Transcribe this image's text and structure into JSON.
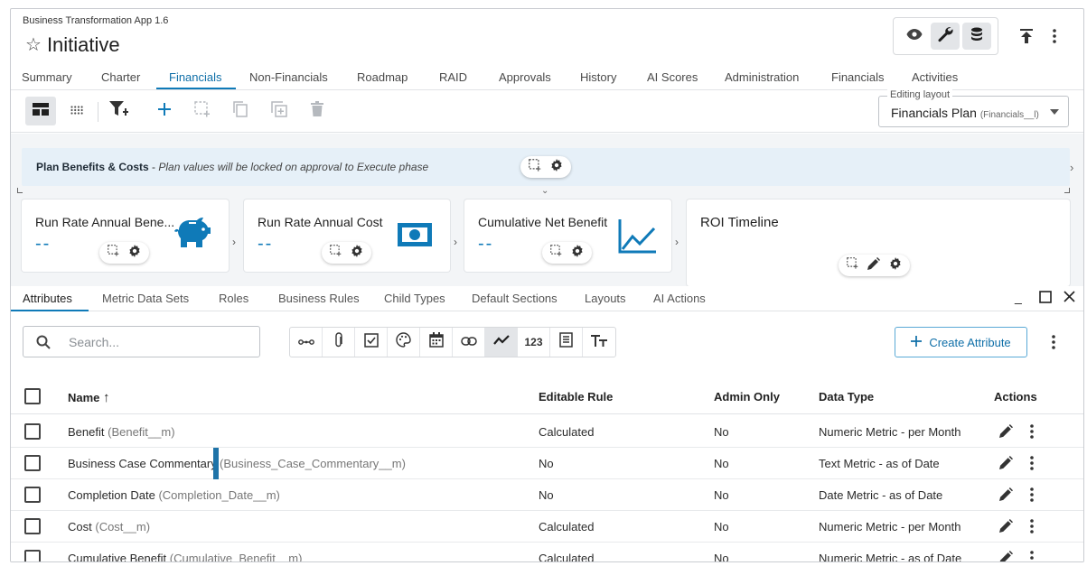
{
  "header": {
    "app_name": "Business Transformation App 1.6",
    "title": "Initiative",
    "star_icon": "☆"
  },
  "tabs": [
    {
      "label": "Summary"
    },
    {
      "label": "Charter"
    },
    {
      "label": "Financials",
      "active": true
    },
    {
      "label": "Non-Financials"
    },
    {
      "label": "Roadmap"
    },
    {
      "label": "RAID"
    },
    {
      "label": "Approvals"
    },
    {
      "label": "History"
    },
    {
      "label": "AI Scores"
    },
    {
      "label": "Administration"
    },
    {
      "label": "Financials"
    },
    {
      "label": "Activities"
    }
  ],
  "layout_select": {
    "label": "Editing layout",
    "value": "Financials Plan",
    "api": "(Financials__l)"
  },
  "banner": {
    "title": "Plan Benefits & Costs",
    "separator": " - ",
    "note": "Plan values will be locked on approval to Execute phase"
  },
  "cards": [
    {
      "title": "Run Rate Annual Bene...",
      "value": "--",
      "icon": "piggy-bank-icon"
    },
    {
      "title": "Run Rate Annual Cost",
      "value": "--",
      "icon": "cash-icon"
    },
    {
      "title": "Cumulative Net Benefit",
      "value": "--",
      "icon": "line-chart-icon"
    },
    {
      "title": "ROI Timeline"
    }
  ],
  "subtabs": [
    {
      "label": "Attributes",
      "active": true
    },
    {
      "label": "Metric Data Sets"
    },
    {
      "label": "Roles"
    },
    {
      "label": "Business Rules"
    },
    {
      "label": "Child Types"
    },
    {
      "label": "Default Sections"
    },
    {
      "label": "Layouts"
    },
    {
      "label": "AI Actions"
    }
  ],
  "search": {
    "placeholder": "Search..."
  },
  "create_button": {
    "label": "Create Attribute"
  },
  "table": {
    "columns": {
      "name": "Name",
      "editable_rule": "Editable Rule",
      "admin_only": "Admin Only",
      "data_type": "Data Type",
      "actions": "Actions"
    },
    "rows": [
      {
        "name": "Benefit",
        "api": "(Benefit__m)",
        "editable_rule": "Calculated",
        "admin_only": "No",
        "data_type": "Numeric Metric - per Month"
      },
      {
        "name": "Business Case Commentary",
        "api": "(Business_Case_Commentary__m)",
        "editable_rule": "No",
        "admin_only": "No",
        "data_type": "Text Metric - as of Date",
        "highlighted": true
      },
      {
        "name": "Completion Date",
        "api": "(Completion_Date__m)",
        "editable_rule": "No",
        "admin_only": "No",
        "data_type": "Date Metric - as of Date"
      },
      {
        "name": "Cost",
        "api": "(Cost__m)",
        "editable_rule": "Calculated",
        "admin_only": "No",
        "data_type": "Numeric Metric - per Month"
      },
      {
        "name": "Cumulative Benefit",
        "api": "(Cumulative_Benefit__m)",
        "editable_rule": "Calculated",
        "admin_only": "No",
        "data_type": "Numeric Metric - as of Date"
      }
    ]
  },
  "colors": {
    "accent": "#0f7ab8",
    "highlight_border": "#1e73a8",
    "banner_bg": "#e6f0f8"
  }
}
